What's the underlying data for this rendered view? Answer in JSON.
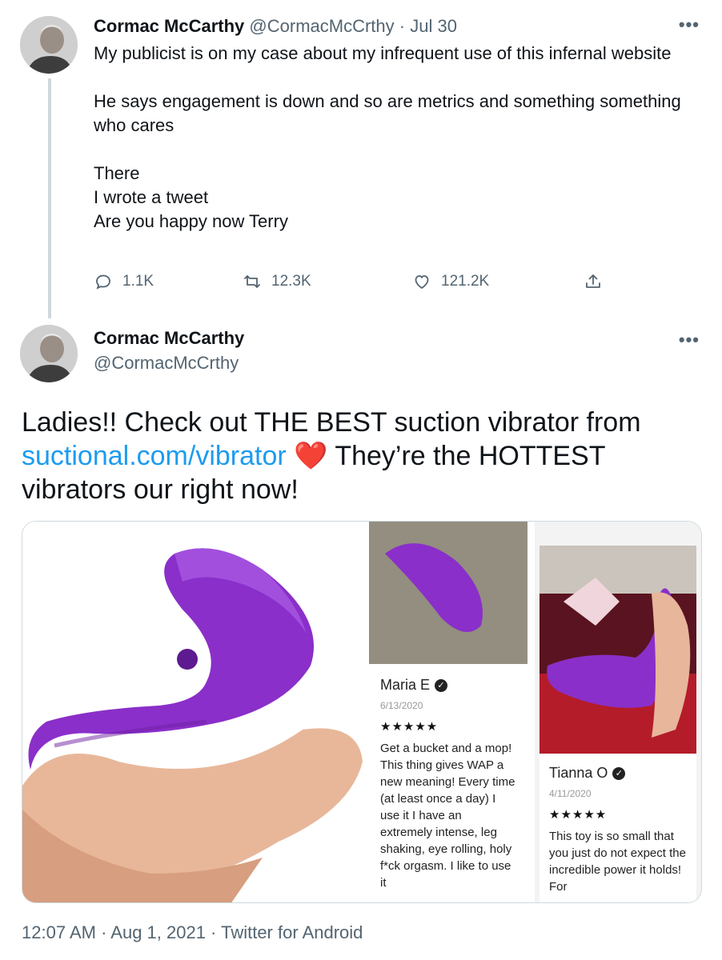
{
  "tweet1": {
    "author_name": "Cormac McCarthy",
    "author_handle": "@CormacMcCrthy",
    "separator": "·",
    "date": "Jul 30",
    "more_label": "•••",
    "lines": [
      "My publicist is on my case about my infrequent use of this infernal website",
      "",
      "He says engagement is down and so are metrics and something something who cares",
      "",
      "There",
      "I wrote a tweet",
      "Are you happy now Terry"
    ],
    "replies": "1.1K",
    "retweets": "12.3K",
    "likes": "121.2K"
  },
  "tweet2": {
    "author_name": "Cormac McCarthy",
    "author_handle": "@CormacMcCrthy",
    "more_label": "•••",
    "text_part1": "Ladies!! Check out THE BEST suction vibrator from ",
    "link": "suctional.com/vibrator",
    "emoji": "❤️",
    "text_part2": " They’re the HOTTEST vibrators our right now!",
    "media": {
      "review1": {
        "name": "Maria E",
        "date": "6/13/2020",
        "stars": "★★★★★",
        "text": "Get a bucket and a mop! This thing gives WAP a new meaning! Every time (at least once a day) I use it I have an extremely intense, leg shaking, eye rolling, holy f*ck orgasm. I like to use it"
      },
      "review2": {
        "name": "Tianna O",
        "date": "4/11/2020",
        "stars": "★★★★★",
        "text": "This toy is so small that you just do not expect the incredible power it holds! For"
      }
    },
    "footer": "12:07 AM · Aug 1, 2021 · Twitter for Android"
  },
  "colors": {
    "link": "#1d9bf0",
    "secondary_text": "#536471",
    "product_purple": "#8a2fc9",
    "heart": "#e0245e"
  }
}
